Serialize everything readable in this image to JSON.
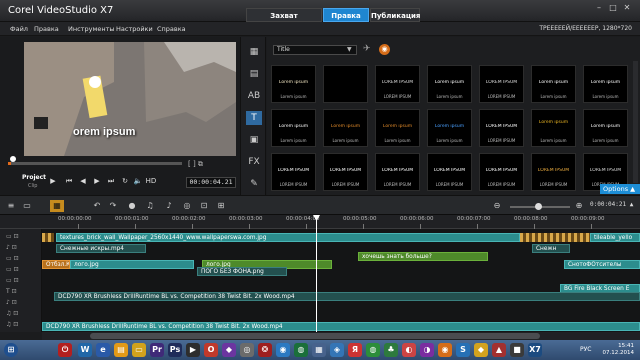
{
  "app": {
    "title_a": "Corel",
    "title_b": "VideoStudio X7"
  },
  "tabs": {
    "capture": "Захват",
    "edit": "Правка",
    "share": "Публикация"
  },
  "menu": [
    "Файл",
    "Правка",
    "Инструменты",
    "Настройки",
    "Справка"
  ],
  "project_info": "ТРЕЕЕЕЕЙ/ЕЕЕЕЕЕР, 1280*720",
  "preview": {
    "overlay_text": "orem ipsum",
    "project_label": "Project",
    "clip_label": "Clip",
    "timecode": "00:00:04.21",
    "hd": "HD"
  },
  "library": {
    "category": "Title",
    "thumbs": [
      "Lorem ipsum",
      "",
      "LOREM IPSUM",
      "Lorem ipsum",
      "LOREM IPSUM",
      "Lorem ipsum",
      "Lorem ipsum",
      "Lorem ipsum",
      "Lorem ipsum",
      "Lorem ipsum",
      "Lorem ipsum",
      "LOREM IPSUM",
      "Lorem ipsum",
      "Lorem ipsum",
      "LOREM IPSUM",
      "LOREM IPSUM",
      "LOREM IPSUM",
      "LOREM IPSUM",
      "LOREM IPSUM",
      "LOREM IPSUM",
      "LOREM IPSUM"
    ],
    "options": "Options ▲"
  },
  "timeline": {
    "timecode": "0:00:04:21 ▲",
    "ruler": [
      "00:00:00:00",
      "00:00:01:00",
      "00:00:02:00",
      "00:00:03:00",
      "00:00:04:00",
      "00:00:05:00",
      "00:00:06:00",
      "00:00:07:00",
      "00:00:08:00",
      "00:00:09:00"
    ],
    "clips": {
      "video": "textures_brick_wall_Wallpaper_2560x1440_www.wallpaperswa.com.jpg",
      "video_end": "tileable_yello",
      "audio1": "Снежные искры.mp4",
      "audio1_end": "Снежн",
      "ovl1_tag": "Отбзл.Ка",
      "ovl1": "лого.jpg",
      "ovl1_b": "лого.jpg",
      "ovl1_c": "СнотоФОтсителы",
      "title1": "хочешь знать больше?",
      "title2": "ПОГО БЕЗ ФОНА.png",
      "bg": "BG Fire Black Screen E",
      "music1": "DCD790 XR Brushless DrillRuntime BL vs. Competition 38 Twist Bit. 2x Wood.mp4",
      "music2": "DCD790 XR Brushless DrillRuntime BL vs. Competition 38 Twist Bit. 2x Wood.mp4"
    }
  },
  "taskbar": {
    "lang": "РУС",
    "time": "15:41",
    "date": "07.12.2014"
  }
}
